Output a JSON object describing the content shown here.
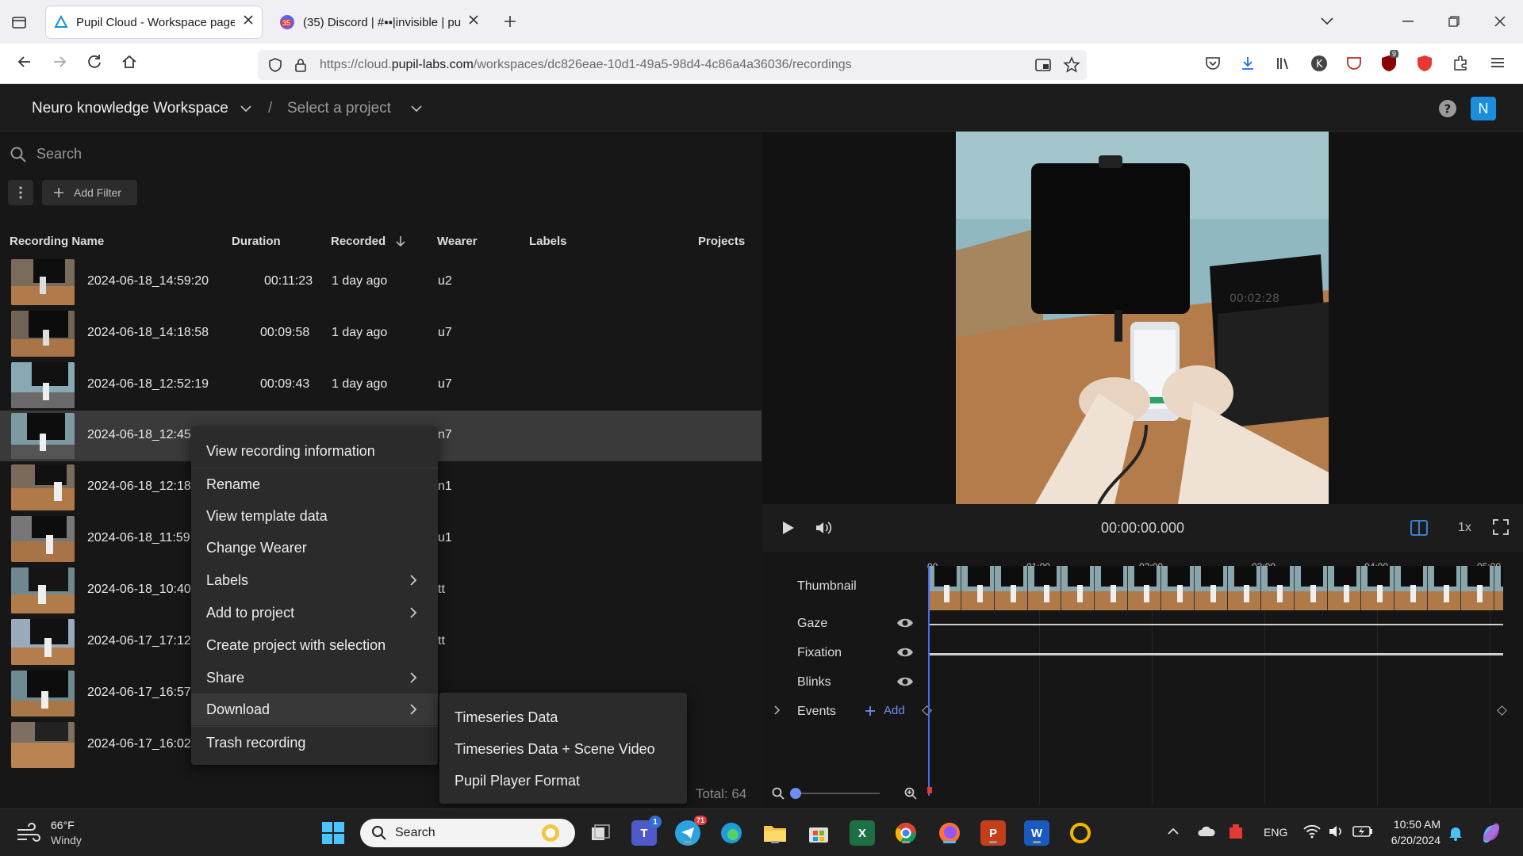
{
  "browser": {
    "tabs": [
      {
        "title": "Pupil Cloud - Workspace page",
        "active": true
      },
      {
        "title": "(35) Discord | #▪▪|invisible | pu",
        "active": false,
        "badge": "35"
      }
    ],
    "url_prefix": "https://cloud.",
    "url_domain": "pupil-labs.com",
    "url_path": "/workspaces/dc826eae-10d1-49a5-98d4-4c86a4a36036/recordings",
    "ext_badge": "9"
  },
  "header": {
    "workspace": "Neuro knowledge Workspace",
    "slash": "/",
    "project": "Select a project",
    "avatar": "N"
  },
  "list": {
    "search_placeholder": "Search",
    "add_filter": "Add Filter",
    "columns": {
      "name": "Recording Name",
      "duration": "Duration",
      "recorded": "Recorded",
      "wearer": "Wearer",
      "labels": "Labels",
      "projects": "Projects"
    },
    "rows": [
      {
        "name": "2024-06-18_14:59:20",
        "duration": "00:11:23",
        "recorded": "1 day ago",
        "wearer": "u2"
      },
      {
        "name": "2024-06-18_14:18:58",
        "duration": "00:09:58",
        "recorded": "1 day ago",
        "wearer": "u7"
      },
      {
        "name": "2024-06-18_12:52:19",
        "duration": "00:09:43",
        "recorded": "1 day ago",
        "wearer": "u7"
      },
      {
        "name": "2024-06-18_12:45",
        "duration": "",
        "recorded": "",
        "wearer": "n7"
      },
      {
        "name": "2024-06-18_12:18",
        "duration": "",
        "recorded": "",
        "wearer": "n1"
      },
      {
        "name": "2024-06-18_11:59",
        "duration": "",
        "recorded": "",
        "wearer": "u1"
      },
      {
        "name": "2024-06-18_10:40",
        "duration": "",
        "recorded": "",
        "wearer": "tt"
      },
      {
        "name": "2024-06-17_17:12:",
        "duration": "",
        "recorded": "",
        "wearer": "tt"
      },
      {
        "name": "2024-06-17_16:57:",
        "duration": "",
        "recorded": "",
        "wearer": ""
      },
      {
        "name": "2024-06-17_16:02",
        "duration": "",
        "recorded": "",
        "wearer": ""
      }
    ],
    "total": "Total: 64"
  },
  "context_menu": {
    "items": [
      {
        "label": "View recording information",
        "submenu": false
      },
      {
        "label": "Rename",
        "submenu": false
      },
      {
        "label": "View template data",
        "submenu": false
      },
      {
        "label": "Change Wearer",
        "submenu": false
      },
      {
        "label": "Labels",
        "submenu": true
      },
      {
        "label": "Add to project",
        "submenu": true
      },
      {
        "label": "Create project with selection",
        "submenu": false
      },
      {
        "label": "Share",
        "submenu": true
      },
      {
        "label": "Download",
        "submenu": true
      },
      {
        "label": "Trash recording",
        "submenu": false
      }
    ],
    "download_submenu": [
      "Timeseries Data",
      "Timeseries Data + Scene Video",
      "Pupil Player Format"
    ]
  },
  "player": {
    "timecode": "00:00:00.000",
    "speed": "1x",
    "ticks": [
      "00",
      "01:00",
      "02:00",
      "03:00",
      "04:00",
      "05:00"
    ],
    "tracks": [
      "Thumbnail",
      "Gaze",
      "Fixation",
      "Blinks",
      "Events"
    ],
    "add_event": "Add"
  },
  "taskbar": {
    "weather_temp": "66°F",
    "weather_desc": "Windy",
    "search": "Search",
    "lang": "ENG",
    "time": "10:50 AM",
    "date": "6/20/2024",
    "teams_badge": "1",
    "telegram_badge": "71"
  }
}
